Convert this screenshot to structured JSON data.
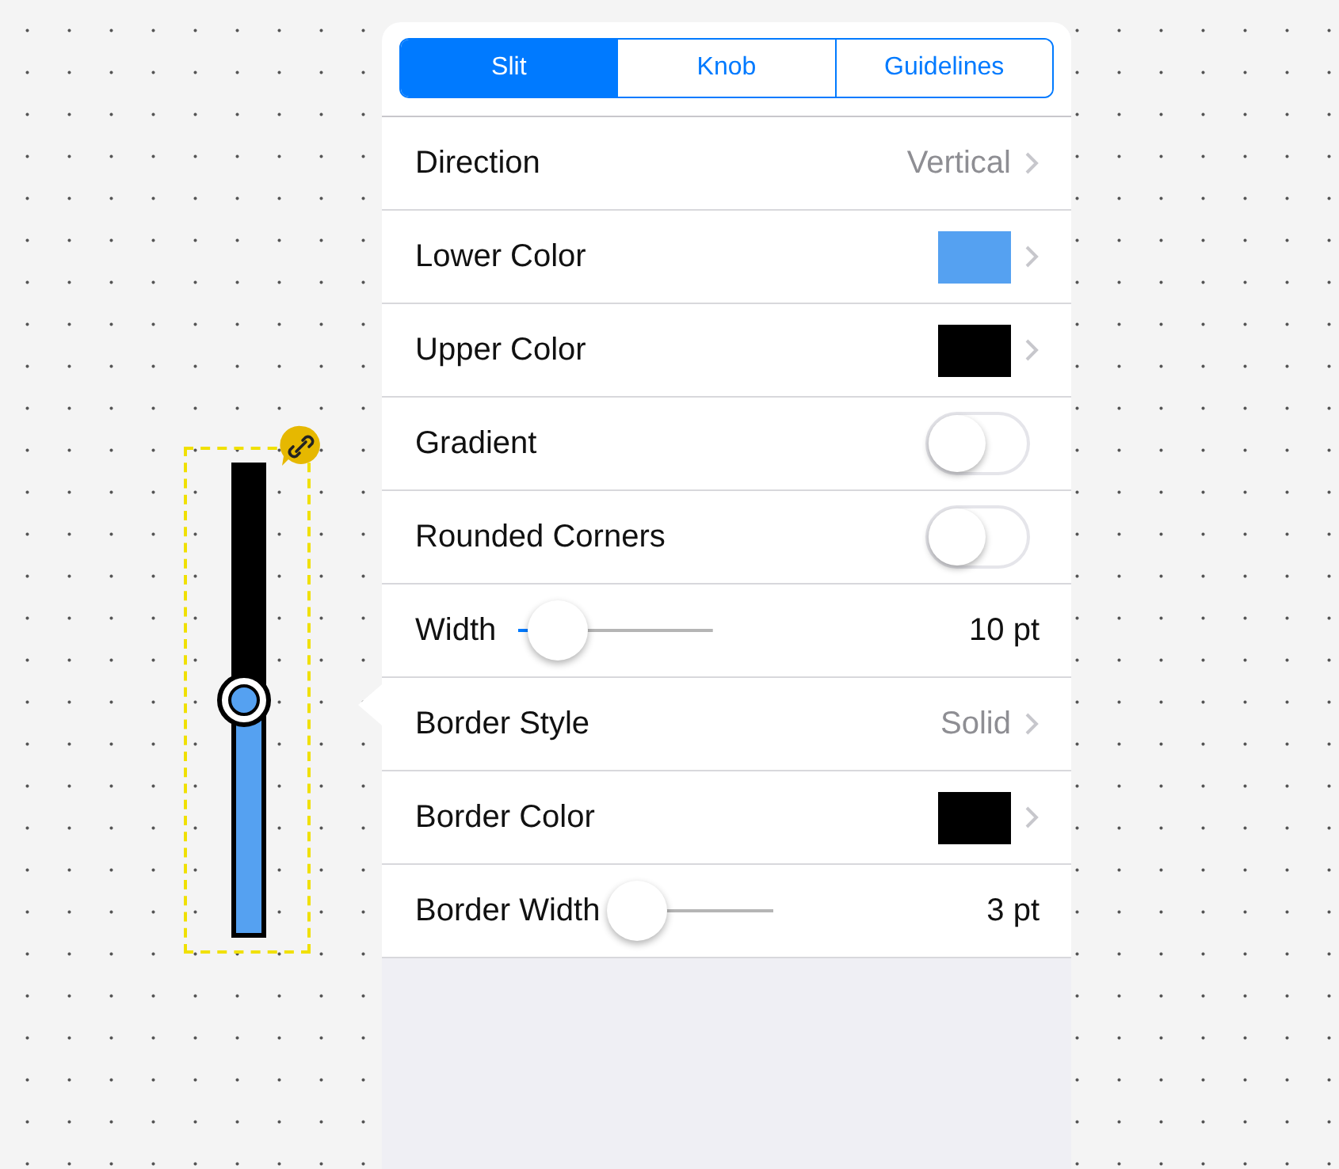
{
  "preview": {
    "level": 0.5
  },
  "tabs": [
    {
      "label": "Slit",
      "selected": true
    },
    {
      "label": "Knob",
      "selected": false
    },
    {
      "label": "Guidelines",
      "selected": false
    }
  ],
  "rows": [
    {
      "kind": "value",
      "label": "Direction",
      "value": "Vertical"
    },
    {
      "kind": "color",
      "label": "Lower Color",
      "color": "#55a1f1"
    },
    {
      "kind": "color",
      "label": "Upper Color",
      "color": "#000000"
    },
    {
      "kind": "toggle",
      "label": "Gradient",
      "on": false
    },
    {
      "kind": "toggle",
      "label": "Rounded Corners",
      "on": false
    },
    {
      "kind": "slider",
      "label": "Width",
      "level": 0.2,
      "value": "10 pt"
    },
    {
      "kind": "value",
      "label": "Border Style",
      "value": "Solid"
    },
    {
      "kind": "color",
      "label": "Border Color",
      "color": "#000000"
    },
    {
      "kind": "slider",
      "label": "Border Width",
      "level": 0.1,
      "value": "3 pt"
    }
  ]
}
